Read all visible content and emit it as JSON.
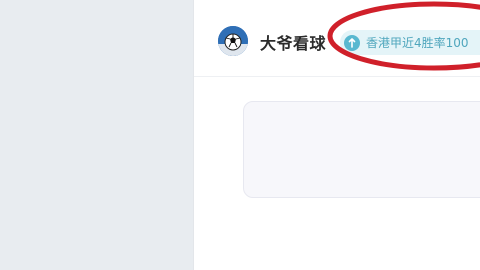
{
  "profile": {
    "name": "大爷看球",
    "badge_text": "香港甲近4胜率100"
  },
  "icons": {
    "avatar": "soccer-ball-avatar",
    "badge": "arrow-up-icon",
    "annotation": "red-ellipse-highlight"
  },
  "colors": {
    "sidebar_bg": "#e8ecf0",
    "badge_bg": "#e4f4f8",
    "badge_text": "#4fa6bd",
    "annotation": "#d0202a"
  }
}
